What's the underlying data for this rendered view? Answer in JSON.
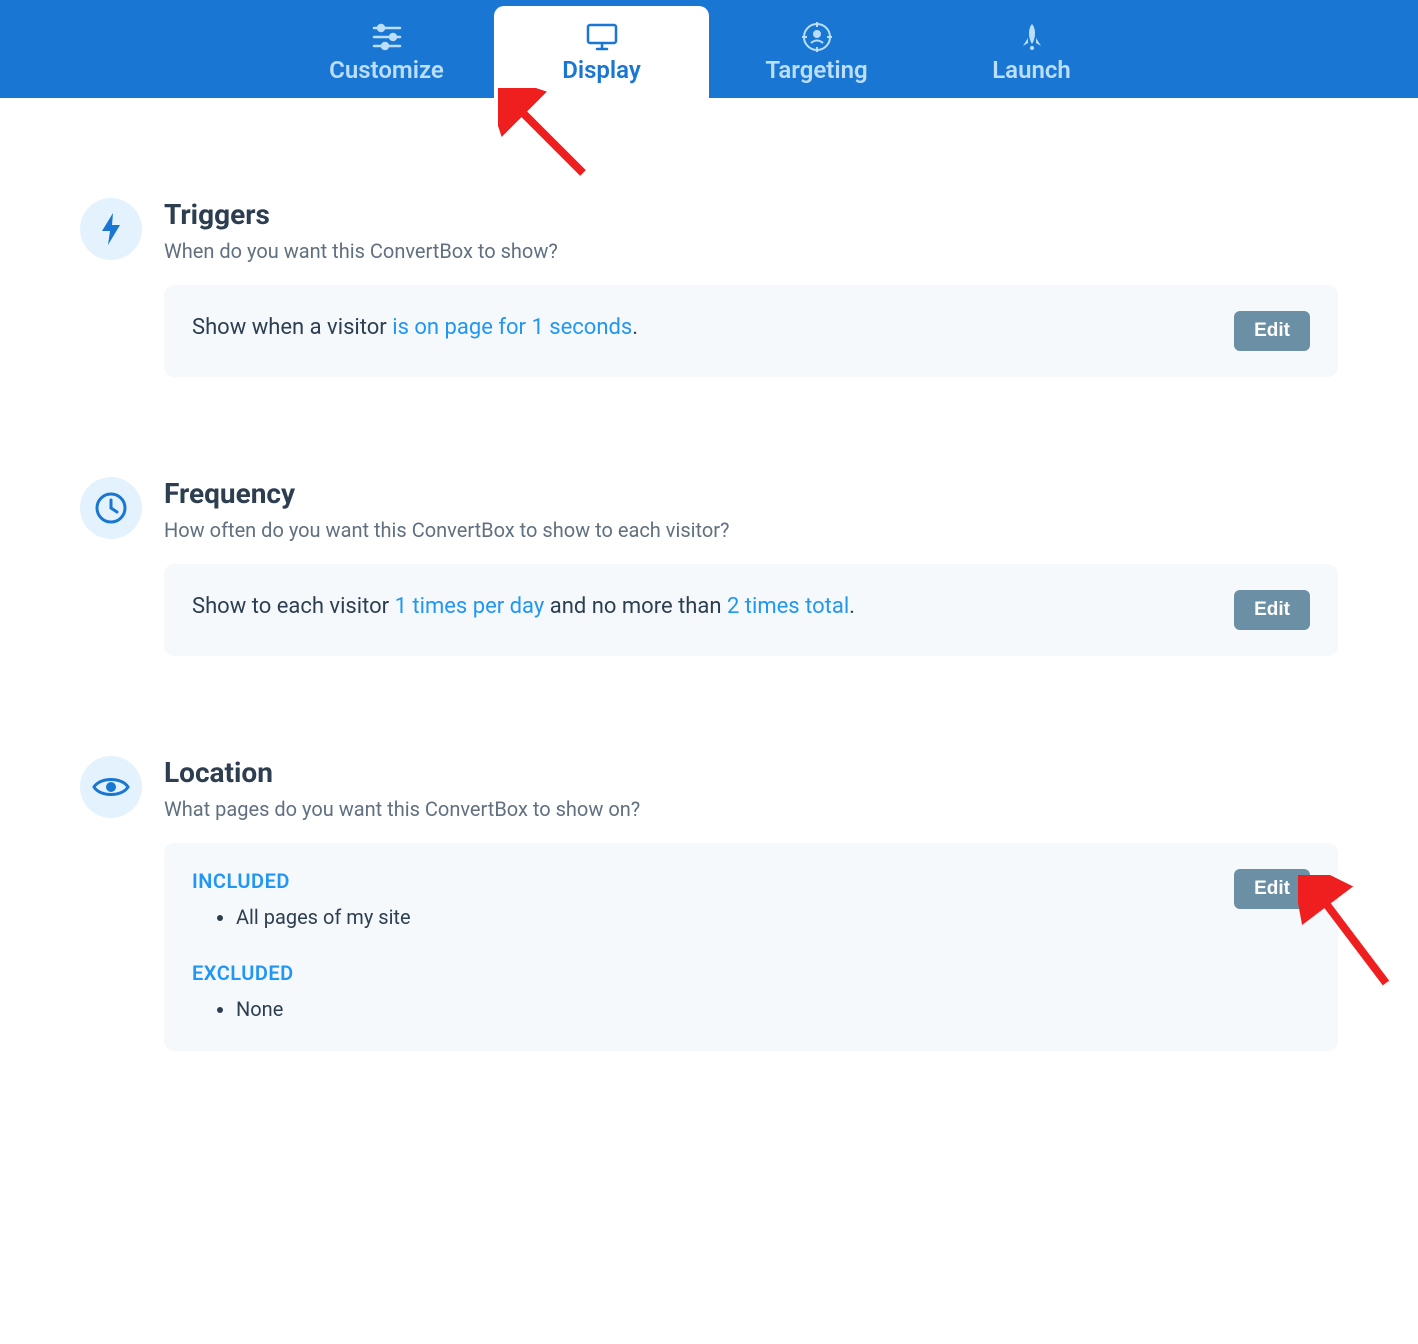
{
  "nav": {
    "tabs": [
      {
        "label": "Customize",
        "icon": "sliders-icon"
      },
      {
        "label": "Display",
        "icon": "monitor-icon"
      },
      {
        "label": "Targeting",
        "icon": "target-icon"
      },
      {
        "label": "Launch",
        "icon": "rocket-icon"
      }
    ],
    "active_index": 1
  },
  "sections": {
    "triggers": {
      "title": "Triggers",
      "desc": "When do you want this ConvertBox to show?",
      "text_prefix": "Show when a visitor ",
      "text_link": "is on page for 1 seconds",
      "text_suffix": ".",
      "edit_label": "Edit"
    },
    "frequency": {
      "title": "Frequency",
      "desc": "How often do you want this ConvertBox to show to each visitor?",
      "text_prefix": "Show to each visitor ",
      "text_link1": "1 times per day",
      "text_mid": " and no more than ",
      "text_link2": "2 times total",
      "text_suffix": ".",
      "edit_label": "Edit"
    },
    "location": {
      "title": "Location",
      "desc": "What pages do you want this ConvertBox to show on?",
      "included_label": "INCLUDED",
      "included_items": [
        "All pages of my site"
      ],
      "excluded_label": "EXCLUDED",
      "excluded_items": [
        "None"
      ],
      "edit_label": "Edit"
    }
  }
}
